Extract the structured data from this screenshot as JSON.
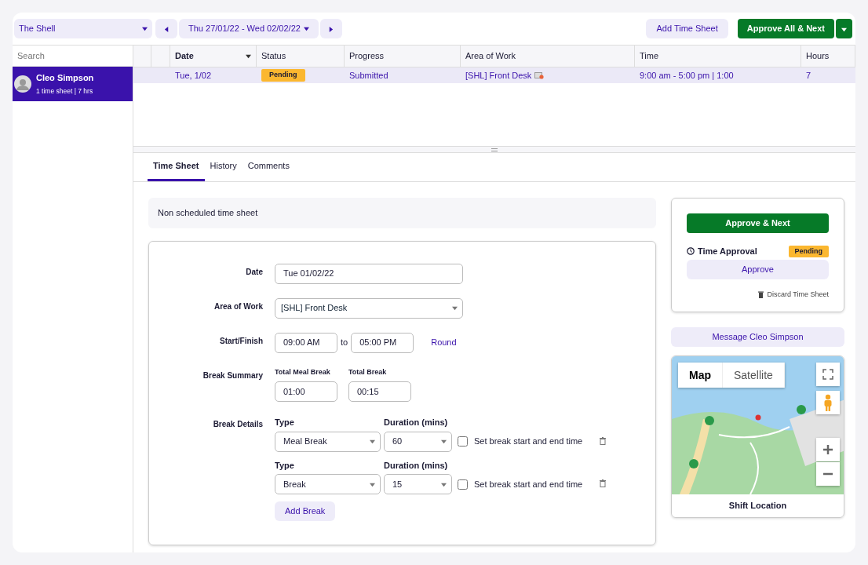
{
  "toolbar": {
    "location": "The Shell",
    "date_range": "Thu 27/01/22 - Wed 02/02/22",
    "add_button": "Add Time Sheet",
    "approve_all_button": "Approve All & Next"
  },
  "sidebar": {
    "search_placeholder": "Search",
    "people": [
      {
        "name": "Cleo Simpson",
        "summary": "1 time sheet | 7 hrs",
        "selected": true
      }
    ]
  },
  "table": {
    "columns": [
      {
        "label": "Date",
        "sorted": true
      },
      {
        "label": "Status",
        "sorted": false
      },
      {
        "label": "Progress",
        "sorted": false
      },
      {
        "label": "Area of Work",
        "sorted": false
      },
      {
        "label": "Time",
        "sorted": false
      },
      {
        "label": "Hours",
        "sorted": false
      }
    ],
    "rows": [
      {
        "date": "Tue, 1/02",
        "status": "Pending",
        "progress": "Submitted",
        "area": "[SHL] Front Desk",
        "time": "9:00 am - 5:00 pm | 1:00",
        "hours": "7",
        "selected": true
      }
    ]
  },
  "tabs": [
    {
      "label": "Time Sheet",
      "selected": true
    },
    {
      "label": "History",
      "selected": false
    },
    {
      "label": "Comments",
      "selected": false
    }
  ],
  "notice": "Non scheduled time sheet",
  "form": {
    "date_label": "Date",
    "date_value": "Tue 01/02/22",
    "area_label": "Area of Work",
    "area_value": "[SHL] Front Desk",
    "start_finish_label": "Start/Finish",
    "start": "09:00 AM",
    "to": "to",
    "finish": "05:00 PM",
    "round_link": "Round",
    "break_summary_label": "Break Summary",
    "total_meal_label": "Total Meal Break",
    "total_meal_value": "01:00",
    "total_break_label": "Total Break",
    "total_break_value": "00:15",
    "break_details_label": "Break Details",
    "breaks": [
      {
        "type_label": "Type",
        "type": "Meal Break",
        "duration_label": "Duration (mins)",
        "duration": "60",
        "checkbox_label": "Set break start and end time",
        "checked": false
      },
      {
        "type_label": "Type",
        "type": "Break",
        "duration_label": "Duration (mins)",
        "duration": "15",
        "checkbox_label": "Set break start and end time",
        "checked": false
      }
    ],
    "add_break": "Add Break"
  },
  "approval": {
    "next_button": "Approve & Next",
    "title": "Time Approval",
    "status": "Pending",
    "approve_button": "Approve",
    "discard": "Discard Time Sheet"
  },
  "message_button": "Message Cleo Simpson",
  "map": {
    "map_types": [
      {
        "label": "Map",
        "selected": true
      },
      {
        "label": "Satellite",
        "selected": false
      }
    ],
    "caption": "Shift Location"
  }
}
